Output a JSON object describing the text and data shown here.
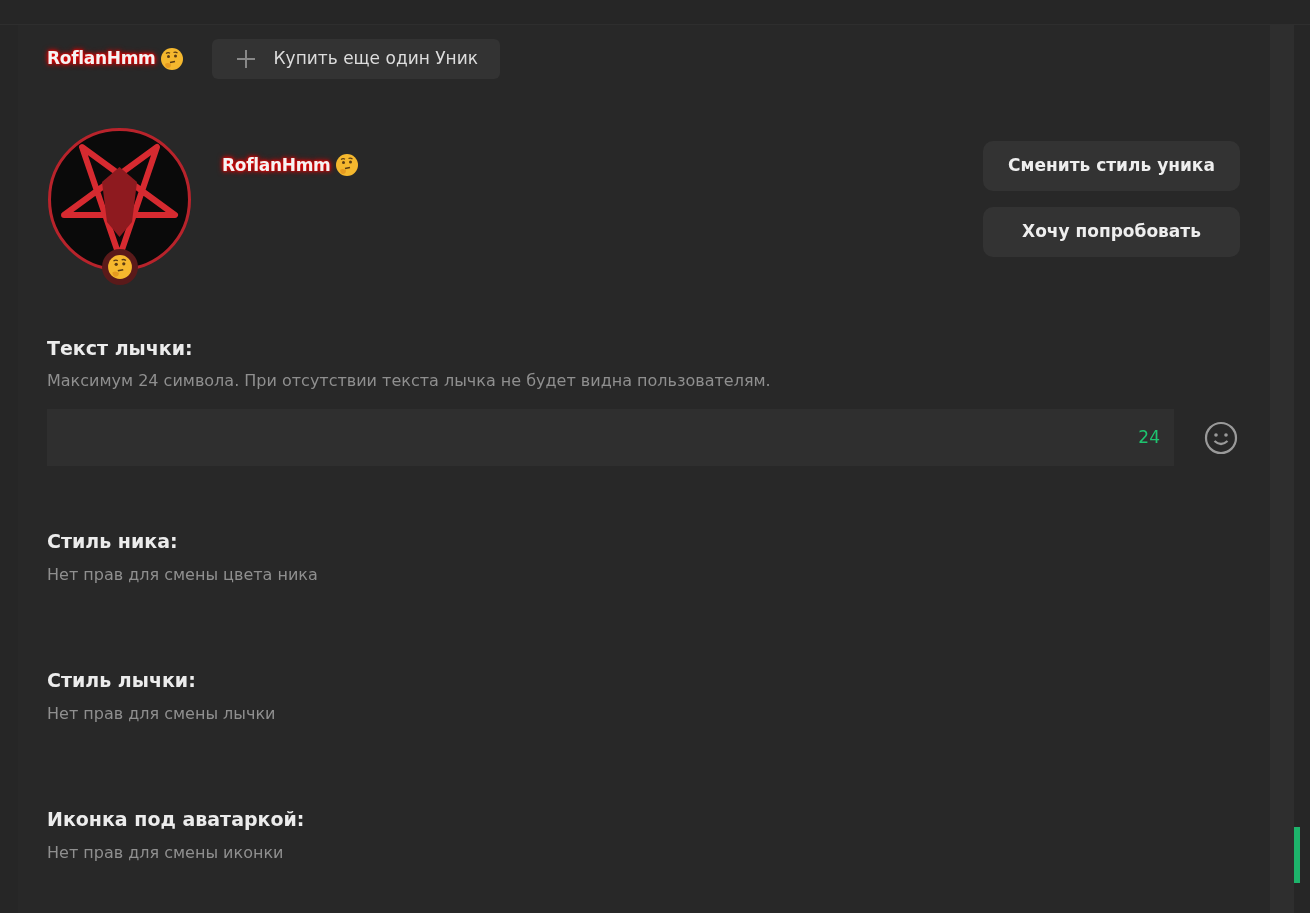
{
  "header": {
    "nick": "RoflanHmm",
    "buy_button": "Купить еще один Уник"
  },
  "profile": {
    "nick": "RoflanHmm"
  },
  "buttons": [
    "Сменить стиль уника",
    "Хочу попробовать"
  ],
  "sections": [
    {
      "kind": "input",
      "title": "Текст лычки:",
      "hint": "Максимум 24 символа. При отсутствии текста лычка не будет видна пользователям.",
      "counter": "24"
    },
    {
      "kind": "note",
      "title": "Стиль ника:",
      "hint": "Нет прав для смены цвета ника"
    },
    {
      "kind": "note",
      "title": "Стиль лычки:",
      "hint": "Нет прав для смены лычки"
    },
    {
      "kind": "note",
      "title": "Иконка под аватаркой:",
      "hint": "Нет прав для смены иконки"
    }
  ]
}
